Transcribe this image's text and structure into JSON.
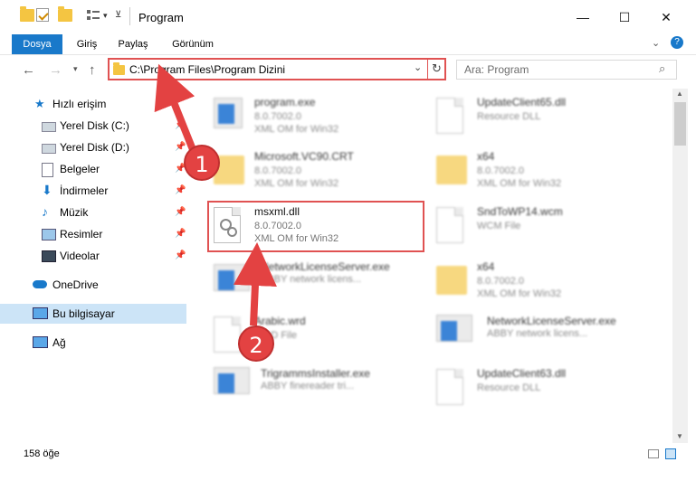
{
  "window": {
    "title": "Program",
    "minimize_glyph": "—",
    "maximize_glyph": "☐",
    "close_glyph": "✕"
  },
  "ribbon": {
    "tabs": [
      "Dosya",
      "Giriş",
      "Paylaş",
      "Görünüm"
    ],
    "accent": "#1979ca"
  },
  "addressbar": {
    "path": "C:\\Program Files\\Program Dizini",
    "search_placeholder": "Ara: Program"
  },
  "nav": {
    "items": [
      {
        "label": "Hızlı erişim",
        "icon": "star-icon"
      },
      {
        "label": "Yerel Disk (C:)",
        "icon": "drive-icon",
        "pinned": true
      },
      {
        "label": "Yerel Disk (D:)",
        "icon": "drive-icon",
        "pinned": true
      },
      {
        "label": "Belgeler",
        "icon": "documents-icon",
        "pinned": true
      },
      {
        "label": "İndirmeler",
        "icon": "download-icon",
        "pinned": true
      },
      {
        "label": "Müzik",
        "icon": "music-icon",
        "pinned": true
      },
      {
        "label": "Resimler",
        "icon": "pictures-icon",
        "pinned": true
      },
      {
        "label": "Videolar",
        "icon": "videos-icon",
        "pinned": true
      },
      {
        "label": "OneDrive",
        "icon": "cloud-icon"
      },
      {
        "label": "Bu bilgisayar",
        "icon": "computer-icon",
        "selected": true
      },
      {
        "label": "Ağ",
        "icon": "network-icon"
      }
    ]
  },
  "files": [
    {
      "name": "program.exe",
      "line2": "8.0.7002.0",
      "line3": "XML OM for Win32",
      "icon": "exe-icon"
    },
    {
      "name": "UpdateClient65.dll",
      "line2": "Resource DLL",
      "line3": "",
      "icon": "dll-icon"
    },
    {
      "name": "Microsoft.VC90.CRT",
      "line2": "8.0.7002.0",
      "line3": "XML OM for Win32",
      "icon": "folder-icon"
    },
    {
      "name": "x64",
      "line2": "8.0.7002.0",
      "line3": "XML OM for Win32",
      "icon": "folder-icon"
    },
    {
      "name": "msxml.dll",
      "line2": "8.0.7002.0",
      "line3": "XML OM for Win32",
      "icon": "dll-icon"
    },
    {
      "name": "SndToWP14.wcm",
      "line2": "WCM File",
      "line3": "",
      "icon": "file-icon"
    },
    {
      "name": "NetworkLicenseServer.exe",
      "line2": "ABBY network licens...",
      "line3": "",
      "icon": "app-icon"
    },
    {
      "name": "x64",
      "line2": "8.0.7002.0",
      "line3": "XML OM for Win32",
      "icon": "folder-icon"
    },
    {
      "name": "Arabic.wrd",
      "line2": "WRD File",
      "line3": "",
      "icon": "file-icon"
    },
    {
      "name": "NetworkLicenseServer.exe",
      "line2": "ABBY network licens...",
      "line3": "",
      "icon": "app-icon"
    },
    {
      "name": "TrigrammsInstaller.exe",
      "line2": "ABBY finereader tri...",
      "line3": "",
      "icon": "app-icon"
    },
    {
      "name": "UpdateClient63.dll",
      "line2": "Resource DLL",
      "line3": "",
      "icon": "dll-icon"
    }
  ],
  "status": {
    "count": "158 öğe"
  },
  "annotations": {
    "step1": "1",
    "step2": "2",
    "color": "#e34242"
  }
}
